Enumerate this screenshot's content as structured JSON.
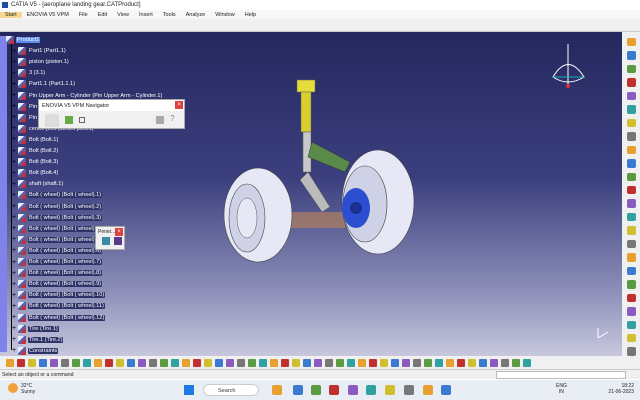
{
  "window": {
    "title": "CATIA V5 - [aeroplane landing gear.CATProduct]"
  },
  "menu": [
    "Start",
    "ENOVIA V5 VPM",
    "File",
    "Edit",
    "View",
    "Insert",
    "Tools",
    "Analyze",
    "Window",
    "Help"
  ],
  "tree": [
    "Product1",
    "Part1 (Part1.1)",
    "piston (piston.1)",
    "3 (3.1)",
    "Part1.1 (Part1.1.1)",
    "Pin Upper Arm - Cylinder (Pin Upper Arm - Cylinder.1)",
    "Pin L",
    "Pin L",
    "centre joint (centre joint.1)",
    "Bolt (Bolt.1)",
    "Bolt (Bolt.2)",
    "Bolt (Bolt.3)",
    "Bolt (Bolt.4)",
    "shaft (shaft.1)",
    "Bolt ( wheel) (Bolt ( wheel).1)",
    "Bolt ( wheel) (Bolt ( wheel).2)",
    "Bolt ( wheel) (Bolt ( wheel).3)",
    "Bolt ( wheel) (Bolt ( wheel).4)",
    "Bolt ( wheel) (Bolt ( wheel).5)",
    "Bolt ( wheel) (Bolt ( wheel).6)",
    "Bolt ( wheel) (Bolt ( wheel).7)",
    "Bolt ( wheel) (Bolt ( wheel).8)",
    "Bolt ( wheel) (Bolt ( wheel).9)",
    "Bolt ( wheel) (Bolt ( wheel).10)",
    "Bolt ( wheel) (Bolt ( wheel).11)",
    "Bolt ( wheel) (Bolt ( wheel).12)",
    "Tire (Tire.1)",
    "Tire.1 (Tire.2)",
    "Constraints"
  ],
  "enovia_panel": {
    "title": "ENOVIA V5 VPM Navigator",
    "logo": "ENOVIA"
  },
  "penet_panel": {
    "title": "Penet..."
  },
  "status": {
    "message": "Select an object or a command"
  },
  "taskbar": {
    "temp": "32°C",
    "weather": "Sunny",
    "search": "Search",
    "lang1": "ENG",
    "lang2": "IN",
    "time": "18:22",
    "date": "21-06-2023"
  }
}
